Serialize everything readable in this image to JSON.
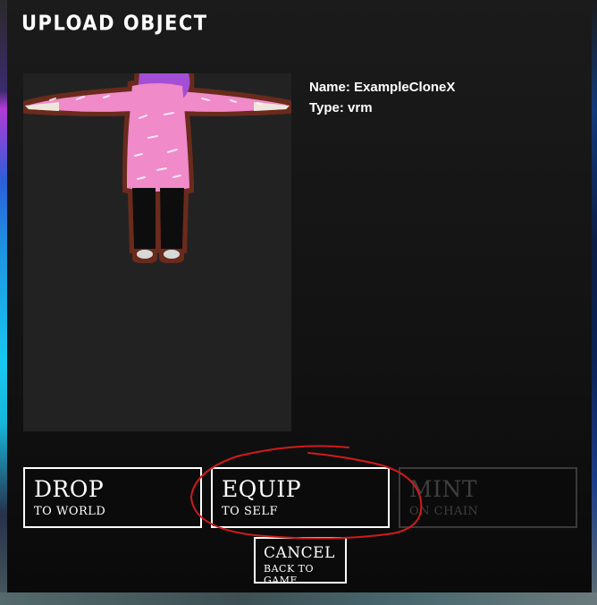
{
  "dialog": {
    "title": "UPLOAD OBJECT"
  },
  "object_info": {
    "name_line": "Name: ExampleCloneX",
    "type_line": "Type: vrm"
  },
  "buttons": {
    "drop": {
      "label": "DROP",
      "sub": "TO WORLD"
    },
    "equip": {
      "label": "EQUIP",
      "sub": "TO SELF"
    },
    "mint": {
      "label": "MINT",
      "sub": "ON CHAIN",
      "state": "disabled"
    },
    "cancel": {
      "label": "CANCEL",
      "sub": "BACK TO GAME"
    }
  },
  "preview": {
    "icon": "avatar-t-pose-preview",
    "colors": {
      "jacket": "#f08ac8",
      "hair": "#a24fd6",
      "outline": "#6b2c1a",
      "pants": "#0d0d0d",
      "skin": "#efe6da"
    }
  },
  "annotation": {
    "color": "#d11a1a",
    "target": "equip-button"
  }
}
